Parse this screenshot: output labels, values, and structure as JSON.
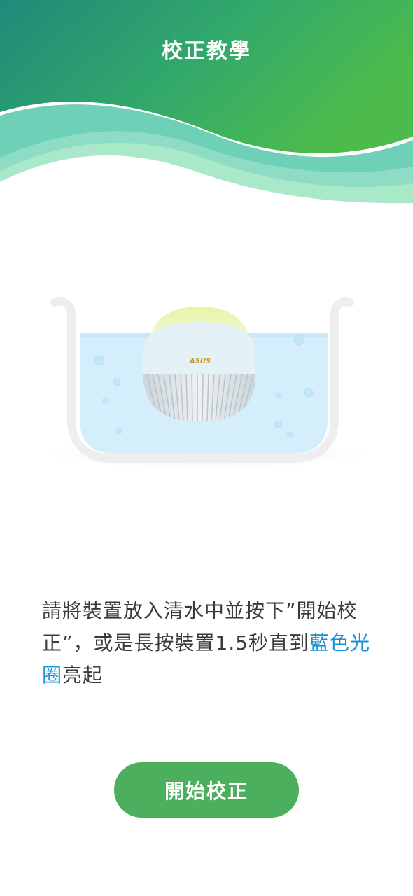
{
  "header": {
    "title": "校正教學"
  },
  "illustration": {
    "brand_label": "ASUS"
  },
  "instruction": {
    "text_part1": "請將裝置放入清水中並按下”開始校正”，或是長按裝置1.5秒直到",
    "highlight": "藍色光圈",
    "text_part2": "亮起"
  },
  "actions": {
    "start_label": "開始校正"
  },
  "colors": {
    "header_gradient_start": "#1f8a7a",
    "header_gradient_end": "#4cbb4c",
    "highlight_text": "#1a8fd6",
    "button_bg": "#4caf5e"
  }
}
